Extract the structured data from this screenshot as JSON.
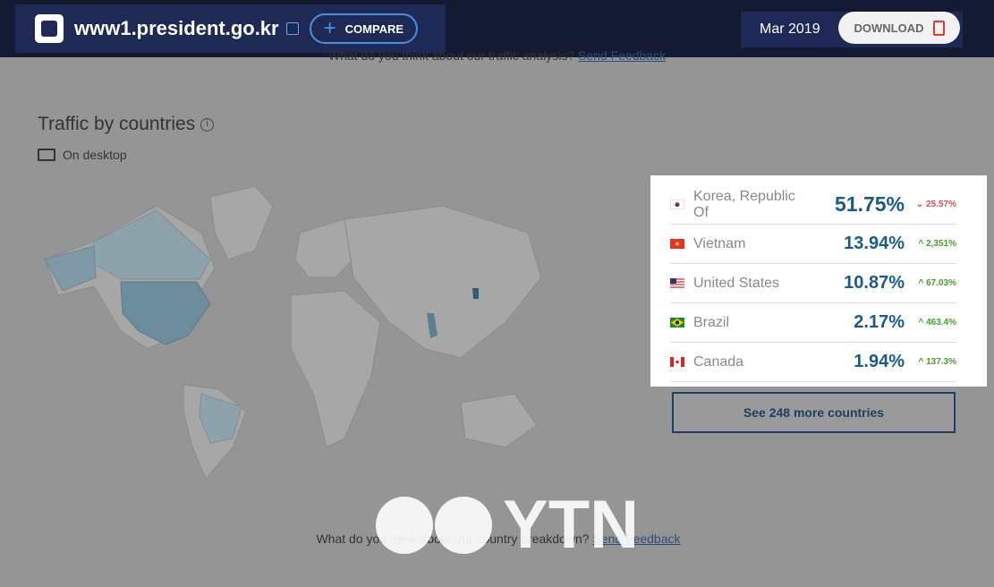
{
  "header": {
    "domain": "www1.president.go.kr",
    "compare_label": "COMPARE",
    "date": "Mar 2019",
    "download_label": "DOWNLOAD"
  },
  "feedback_top": {
    "text": "What do you think about our traffic analysis?",
    "link": "Send Feedback"
  },
  "section": {
    "title": "Traffic by countries",
    "device": "On desktop"
  },
  "countries": [
    {
      "name": "Korea, Republic Of",
      "share": "51.75%",
      "change": "25.57%",
      "direction": "down",
      "flag": "kr"
    },
    {
      "name": "Vietnam",
      "share": "13.94%",
      "change": "2,351%",
      "direction": "up",
      "flag": "vn"
    },
    {
      "name": "United States",
      "share": "10.87%",
      "change": "67.03%",
      "direction": "up",
      "flag": "us"
    },
    {
      "name": "Brazil",
      "share": "2.17%",
      "change": "463.4%",
      "direction": "up",
      "flag": "br"
    },
    {
      "name": "Canada",
      "share": "1.94%",
      "change": "137.3%",
      "direction": "up",
      "flag": "ca"
    }
  ],
  "more_button": "See 248 more countries",
  "feedback_bottom": {
    "text": "What do you think about our country breakdown?",
    "link": "Send Feedback"
  },
  "watermark": "YTN",
  "colors": {
    "up": "#4b9a2f",
    "down": "#e04a5a",
    "share": "#1c5a88",
    "nav": "#141a33"
  }
}
